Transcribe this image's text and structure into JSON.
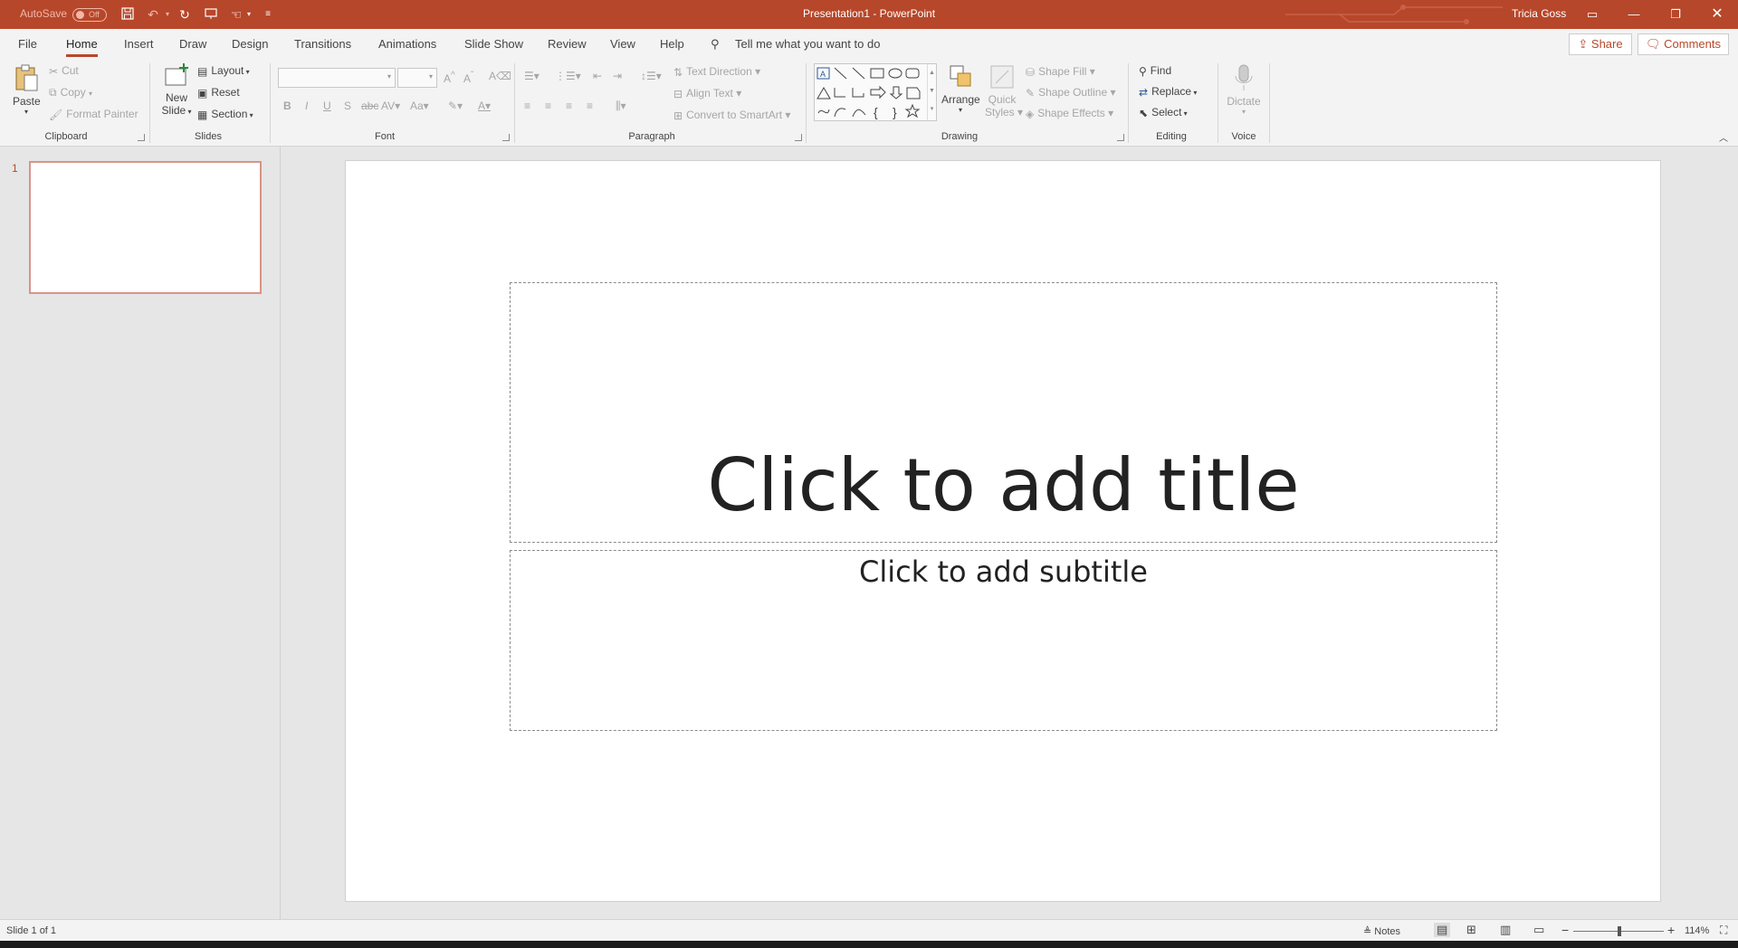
{
  "titlebar": {
    "autosave_label": "AutoSave",
    "autosave_state": "Off",
    "document_title": "Presentation1  -  PowerPoint",
    "user_name": "Tricia Goss",
    "accent_color": "#b7472a"
  },
  "tabs": [
    "File",
    "Home",
    "Insert",
    "Draw",
    "Design",
    "Transitions",
    "Animations",
    "Slide Show",
    "Review",
    "View",
    "Help"
  ],
  "active_tab": "Home",
  "tell_me": "Tell me what you want to do",
  "share_label": "Share",
  "comments_label": "Comments",
  "ribbon": {
    "clipboard": {
      "label": "Clipboard",
      "paste": "Paste",
      "cut": "Cut",
      "copy": "Copy",
      "format_painter": "Format Painter"
    },
    "slides": {
      "label": "Slides",
      "new_slide_1": "New",
      "new_slide_2": "Slide",
      "layout": "Layout",
      "reset": "Reset",
      "section": "Section"
    },
    "font": {
      "label": "Font"
    },
    "paragraph": {
      "label": "Paragraph",
      "text_direction": "Text Direction",
      "align_text": "Align Text",
      "convert_smartart": "Convert to SmartArt"
    },
    "drawing": {
      "label": "Drawing",
      "arrange": "Arrange",
      "quick_styles_1": "Quick",
      "quick_styles_2": "Styles",
      "shape_fill": "Shape Fill",
      "shape_outline": "Shape Outline",
      "shape_effects": "Shape Effects"
    },
    "editing": {
      "label": "Editing",
      "find": "Find",
      "replace": "Replace",
      "select": "Select"
    },
    "voice": {
      "label": "Voice",
      "dictate": "Dictate"
    }
  },
  "thumbnails": [
    {
      "number": "1"
    }
  ],
  "slide": {
    "title_placeholder": "Click to add title",
    "subtitle_placeholder": "Click to add subtitle"
  },
  "status": {
    "slide_info": "Slide 1 of 1",
    "notes": "Notes",
    "zoom": "114%"
  }
}
